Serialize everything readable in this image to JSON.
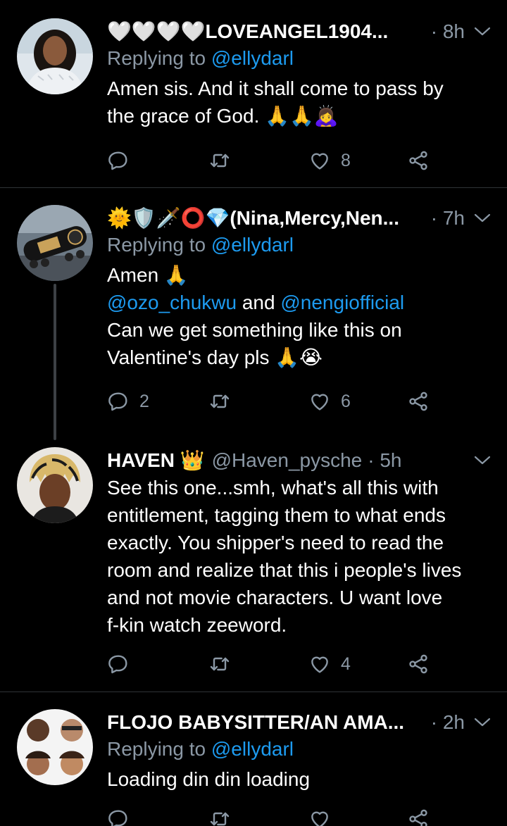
{
  "tweets": [
    {
      "name": "🤍🤍🤍🤍LOVEANGEL1904...",
      "time": "· 8h",
      "replying_prefix": "Replying to ",
      "replying_to": "@ellydarl",
      "lines": [
        "Amen sis. And it shall come to pass by",
        "the grace of God. 🙏🙏🙇‍♀️"
      ],
      "reply_count": "",
      "like_count": "8"
    },
    {
      "name": "🌞🛡️🗡️⭕💎(Nina,Mercy,Nen...",
      "time": "· 7h",
      "replying_prefix": "Replying to ",
      "replying_to": "@ellydarl",
      "line1": "Amen 🙏",
      "mention1": "@ozo_chukwu",
      "and": " and ",
      "mention2": "@nengiofficial",
      "line3": "Can we get something like this on",
      "line4": "Valentine's day pls 🙏😭",
      "reply_count": "2",
      "like_count": "6"
    },
    {
      "name": "HAVEN 👑",
      "handle": "@Haven_pysche",
      "time": "· 5h",
      "lines": [
        "See this one...smh, what's all this with",
        "entitlement, tagging them to what ends",
        "exactly. You shipper's need to read the",
        "room and realize that this i people's lives",
        "and not movie characters. U want love",
        "f-kin watch zeeword."
      ],
      "reply_count": "",
      "like_count": "4"
    },
    {
      "name": "FLOJO BABYSITTER/AN AMA...",
      "time": "· 2h",
      "replying_prefix": "Replying to ",
      "replying_to": "@ellydarl",
      "lines": [
        "Loading din din loading"
      ],
      "reply_count": "",
      "like_count": ""
    }
  ],
  "icons": {
    "reply": "reply-icon",
    "retweet": "retweet-icon",
    "like": "heart-icon",
    "share": "share-icon",
    "more": "chevron-down-icon"
  },
  "colors": {
    "background": "#000000",
    "text": "#ffffff",
    "secondary": "#8b98a5",
    "link": "#1d9bf0",
    "divider": "#2f3336"
  }
}
